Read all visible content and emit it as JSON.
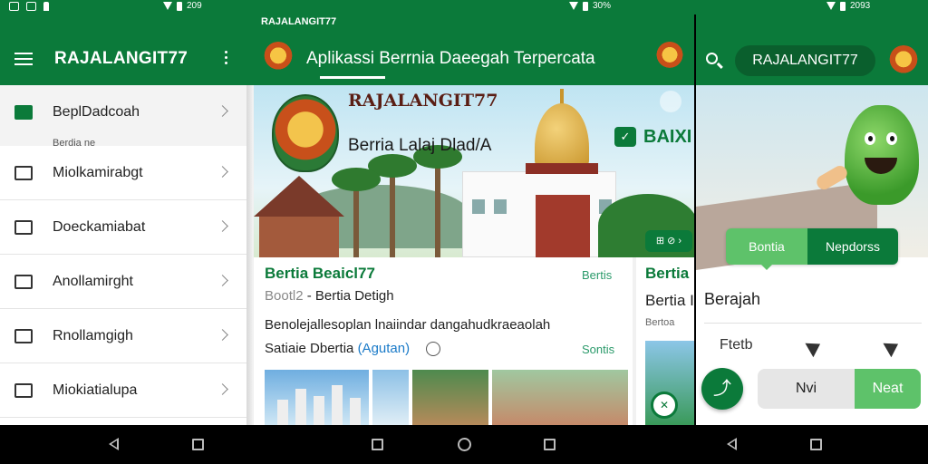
{
  "status_bar": {
    "left_text": "",
    "mid_text": "209",
    "mid2_text": "30%",
    "right_text": "2093"
  },
  "drawer": {
    "title": "RAJALANGIT77",
    "items": [
      {
        "label": "BeplDadcoah",
        "sub": "Berdia ne",
        "icon": "wallet-icon"
      },
      {
        "label": "Miolkamirabgt",
        "icon": "calendar-icon"
      },
      {
        "label": "Doeckamiabat",
        "icon": "camera-icon"
      },
      {
        "label": "Anollamirght",
        "icon": "list-icon"
      },
      {
        "label": "Rnollamgigh",
        "icon": "grid-icon"
      },
      {
        "label": "Miokiatialupa",
        "icon": "table-icon"
      }
    ]
  },
  "main": {
    "brand": "RAJALANGIT77",
    "title": "Aplikassi Berrnia Daeegah Terpercata",
    "hero": {
      "title": "RAJALANGIT77",
      "subtitle": "Berria Lalaj Dlad/A",
      "badge_text": "BAIXI",
      "control_text": "⊞ ⊘ ›"
    },
    "card": {
      "title": "Bertia Beaicl77",
      "tag": "Bertis",
      "meta_prefix": "Bootl2",
      "meta_text": " - Bertia Detigh",
      "text": "Benolejallesoplan lnaiindar dangahudkraeaolah",
      "text2_prefix": "Satiaie Dbertia ",
      "text2_link": "(Agutan)",
      "tag2": "Sontis"
    },
    "card2": {
      "title": "Bertia",
      "subtitle": "Bertia I",
      "tag": "Bertoa"
    }
  },
  "right": {
    "pill_label": "RAJALANGIT77",
    "seg_a": "Bontia",
    "seg_b": "Nepdorss",
    "heading": "Berajah",
    "row_label": "Ftetb",
    "fab_label": "⤴",
    "prev_label": "Nvi",
    "next_label": "Neat"
  },
  "colors": {
    "brand_green": "#0b7a3a",
    "accent_green": "#5ec26a",
    "link_blue": "#1a7ac8"
  }
}
